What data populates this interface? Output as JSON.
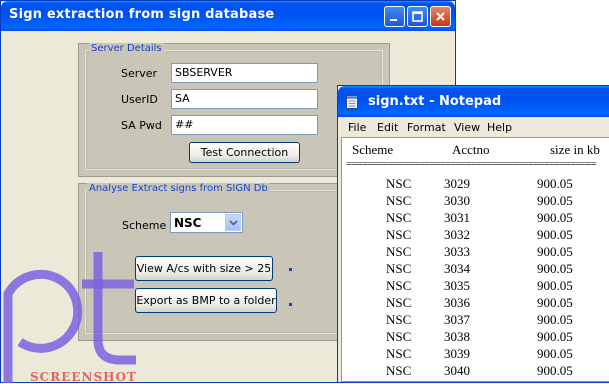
{
  "main_window": {
    "title": "Sign extraction from sign database",
    "server_group": {
      "legend": "Server Details",
      "server_label": "Server",
      "server_value": "SBSERVER",
      "userid_label": "UserID",
      "userid_value": "SA",
      "pwd_label": "SA Pwd",
      "pwd_value": "##",
      "test_button": "Test Connection"
    },
    "analyse_group": {
      "legend": "Analyse  Extract signs from SIGN Db",
      "scheme_label": "Scheme",
      "scheme_value": "NSC",
      "view_button": "View A/cs with size > 25",
      "export_button": "Export as BMP to a folder"
    }
  },
  "watermark": {
    "text": "SCREENSHOT"
  },
  "notepad": {
    "title": "sign.txt - Notepad",
    "menu": [
      "File",
      "Edit",
      "Format",
      "View",
      "Help"
    ],
    "headers": {
      "scheme": "Scheme",
      "acctno": "Acctno",
      "size": "size in kb"
    },
    "separator": "================================================",
    "rows": [
      {
        "scheme": "NSC",
        "acctno": "3029",
        "size": "900.05"
      },
      {
        "scheme": "NSC",
        "acctno": "3030",
        "size": "900.05"
      },
      {
        "scheme": "NSC",
        "acctno": "3031",
        "size": "900.05"
      },
      {
        "scheme": "NSC",
        "acctno": "3032",
        "size": "900.05"
      },
      {
        "scheme": "NSC",
        "acctno": "3033",
        "size": "900.05"
      },
      {
        "scheme": "NSC",
        "acctno": "3034",
        "size": "900.05"
      },
      {
        "scheme": "NSC",
        "acctno": "3035",
        "size": "900.05"
      },
      {
        "scheme": "NSC",
        "acctno": "3036",
        "size": "900.05"
      },
      {
        "scheme": "NSC",
        "acctno": "3037",
        "size": "900.05"
      },
      {
        "scheme": "NSC",
        "acctno": "3038",
        "size": "900.05"
      },
      {
        "scheme": "NSC",
        "acctno": "3039",
        "size": "900.05"
      },
      {
        "scheme": "NSC",
        "acctno": "3040",
        "size": "900.05"
      }
    ]
  },
  "colors": {
    "title_blue": "#0053ee",
    "group_label_blue": "#1a3fd0",
    "watermark": "#7b61e0"
  }
}
